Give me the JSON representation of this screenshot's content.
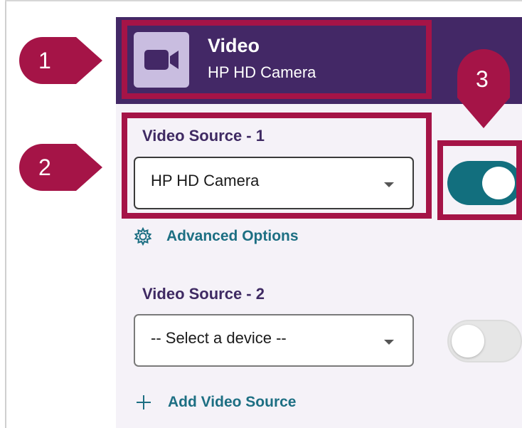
{
  "header": {
    "title": "Video",
    "subtitle": "HP HD Camera",
    "icon": "video-camera-icon"
  },
  "sources": [
    {
      "label": "Video Source - 1",
      "selected": "HP HD Camera",
      "enabled": true
    },
    {
      "label": "Video Source - 2",
      "selected": "-- Select a device --",
      "enabled": false
    }
  ],
  "advanced_options": "Advanced Options",
  "add_source": "Add Video Source",
  "callouts": [
    "1",
    "2",
    "3"
  ],
  "colors": {
    "header_bg": "#432866",
    "accent": "#126f7e",
    "callout": "#a51447",
    "panel_bg": "#f5f2f8",
    "label": "#3f2a63",
    "link": "#1d6f83"
  }
}
